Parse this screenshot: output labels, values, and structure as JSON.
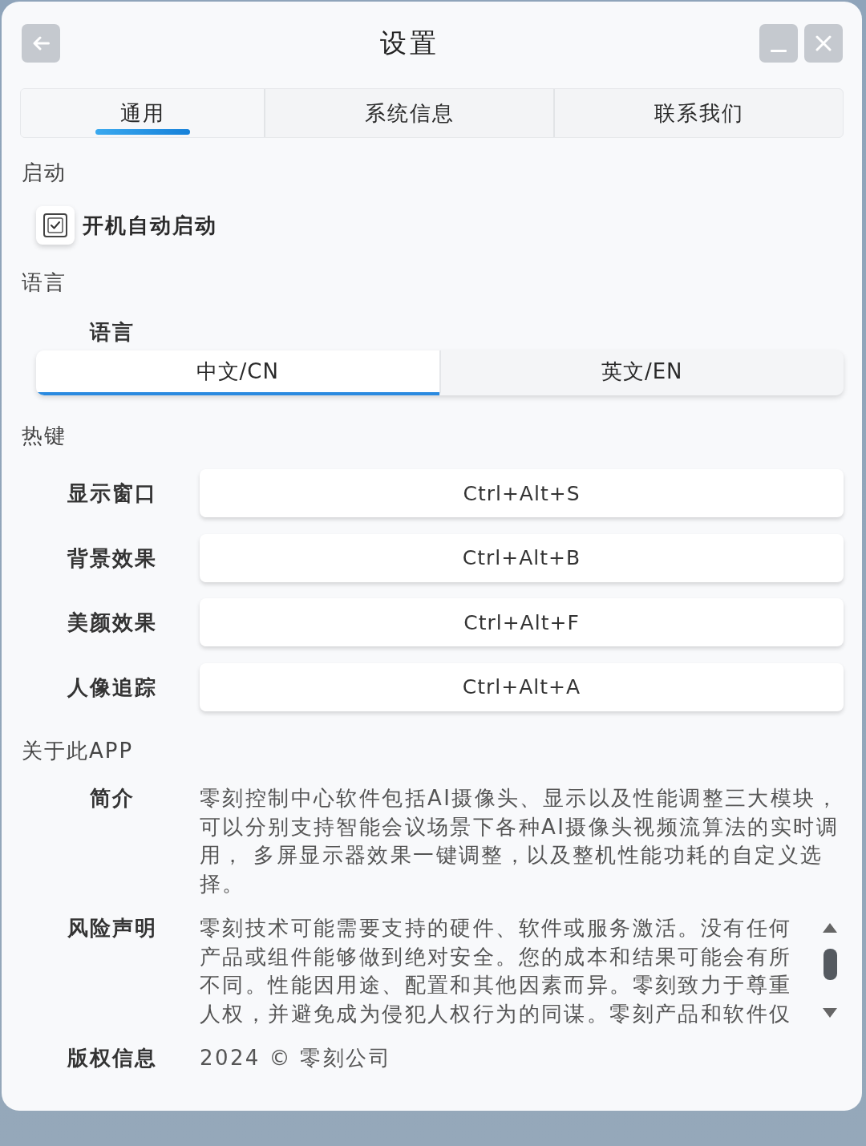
{
  "window": {
    "title": "设置"
  },
  "tabs": [
    {
      "label": "通用",
      "selected": true
    },
    {
      "label": "系统信息",
      "selected": false
    },
    {
      "label": "联系我们",
      "selected": false
    }
  ],
  "startup": {
    "heading": "启动",
    "checkboxes": [
      {
        "label": "开机自动启动",
        "checked": true
      }
    ]
  },
  "language": {
    "heading": "语言",
    "label": "语言",
    "options": [
      {
        "label": "中文/CN",
        "selected": true
      },
      {
        "label": "英文/EN",
        "selected": false
      }
    ]
  },
  "hotkeys": {
    "heading": "热键",
    "rows": [
      {
        "label": "显示窗口",
        "shortcut": "Ctrl+Alt+S"
      },
      {
        "label": "背景效果",
        "shortcut": "Ctrl+Alt+B"
      },
      {
        "label": "美颜效果",
        "shortcut": "Ctrl+Alt+F"
      },
      {
        "label": "人像追踪",
        "shortcut": "Ctrl+Alt+A"
      }
    ]
  },
  "about": {
    "heading": "关于此APP",
    "rows": [
      {
        "kind": "plain",
        "label": "简介",
        "text": "零刻控制中心软件包括AI摄像头、显示以及性能调整三大模块，可以分别支持智能会议场景下各种AI摄像头视频流算法的实时调用， 多屏显示器效果一键调整，以及整机性能功耗的自定义选择。"
      },
      {
        "kind": "scroll",
        "label": "风险声明",
        "text": "零刻技术可能需要支持的硬件、软件或服务激活。没有任何产品或组件能够做到绝对安全。您的成本和结果可能会有所不同。性能因用途、配置和其他因素而异。零刻致力于尊重人权，并避免成为侵犯人权行为的同谋。零刻产品和软件仅"
      },
      {
        "kind": "plain",
        "label": "版权信息",
        "text": "2024 © 零刻公司"
      }
    ]
  }
}
